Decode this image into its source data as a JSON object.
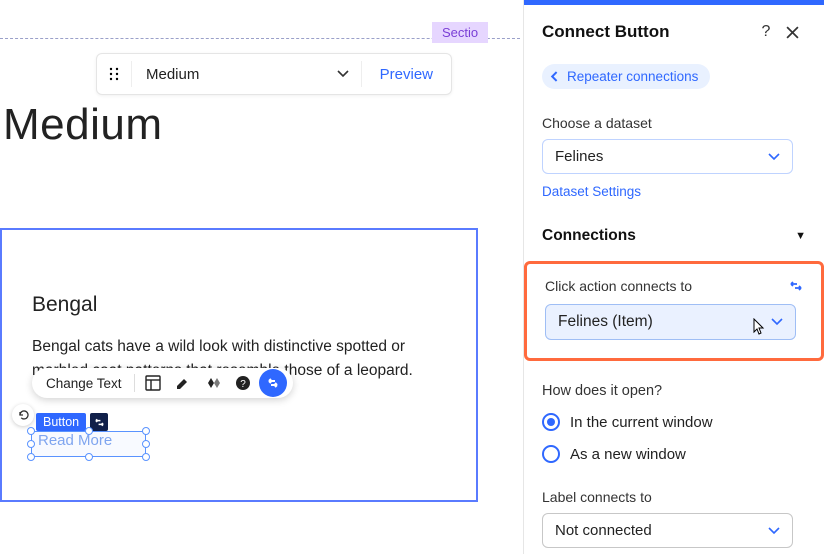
{
  "section_tag": "Sectio",
  "toolbar": {
    "label": "Medium",
    "preview": "Preview"
  },
  "heading": "Medium",
  "card": {
    "title": "Bengal",
    "body": "Bengal cats have a wild look with distinctive spotted or marbled coat patterns that resemble those of a leopard."
  },
  "float": {
    "change_text": "Change Text"
  },
  "button_badge": "Button",
  "button_text": "Read More",
  "panel": {
    "title": "Connect Button",
    "back_pill": "Repeater connections",
    "dataset_label": "Choose a dataset",
    "dataset_value": "Felines",
    "dataset_settings": "Dataset Settings",
    "connections_header": "Connections",
    "click_label": "Click action connects to",
    "click_value": "Felines (Item)",
    "open_q": "How does it open?",
    "open_opts": [
      "In the current window",
      "As a new window"
    ],
    "label_label": "Label connects to",
    "label_value": "Not connected"
  }
}
